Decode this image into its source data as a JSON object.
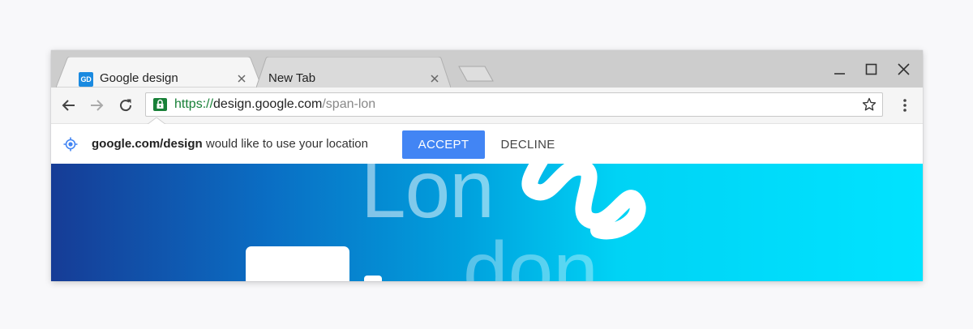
{
  "tabs": [
    {
      "favicon_text": "GD",
      "title": "Google design",
      "active": true
    },
    {
      "title": "New Tab",
      "active": false
    }
  ],
  "window_controls": [
    "minimize-icon",
    "maximize-icon",
    "close-icon"
  ],
  "toolbar": {
    "back_icon": "back-arrow-icon",
    "forward_icon": "forward-arrow-icon",
    "reload_icon": "reload-icon",
    "menu_icon": "more-vert-icon"
  },
  "omnibox": {
    "url_scheme": "https://",
    "url_host": "design.google.com",
    "url_path": "/span-lon",
    "secure": true
  },
  "infobar": {
    "icon": "location-target-icon",
    "site": "google.com/design",
    "message": " would like to use your location",
    "accept_label": "ACCEPT",
    "decline_label": "DECLINE"
  },
  "content": {
    "text_line1": "Lon",
    "text_line2": "don"
  },
  "colors": {
    "accent_button": "#4285f4",
    "secure_green": "#188038",
    "tabstrip_bg": "#cdcdcd",
    "gradient_start": "#163c96",
    "gradient_end": "#00e3ff"
  }
}
